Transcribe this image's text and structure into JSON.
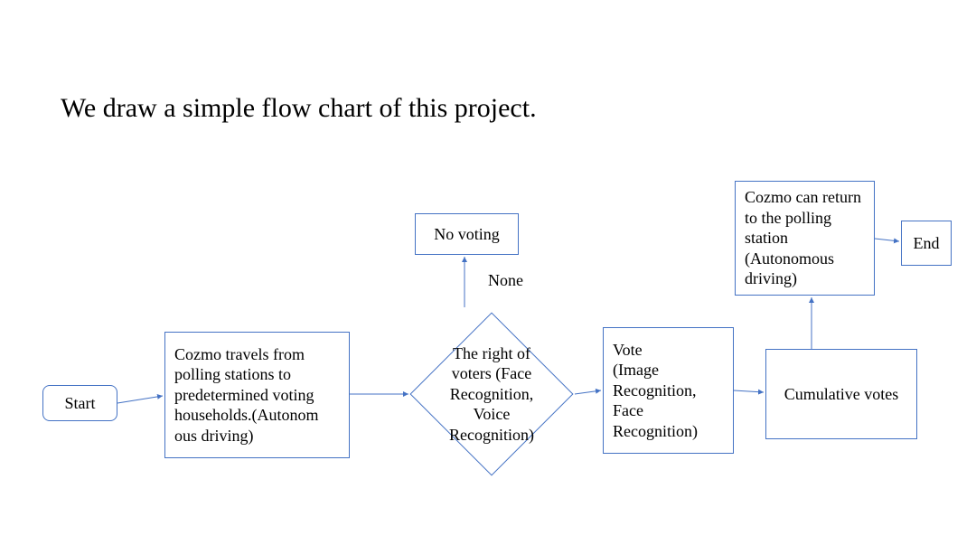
{
  "title": "We draw a simple flow chart of this project.",
  "nodes": {
    "start": "Start",
    "travel": "Cozmo travels from polling stations to predetermined voting households.(Autonom ous driving)",
    "decision": "The right of voters (Face Recognition, Voice Recognition)",
    "no_voting": "No voting",
    "none_label": "None",
    "vote": "Vote\n(Image Recognition, Face Recognition)",
    "cumulative": "Cumulative votes",
    "return": "Cozmo can return to the polling station (Autonomous driving)",
    "end": "End"
  },
  "colors": {
    "border": "#4472C4"
  }
}
